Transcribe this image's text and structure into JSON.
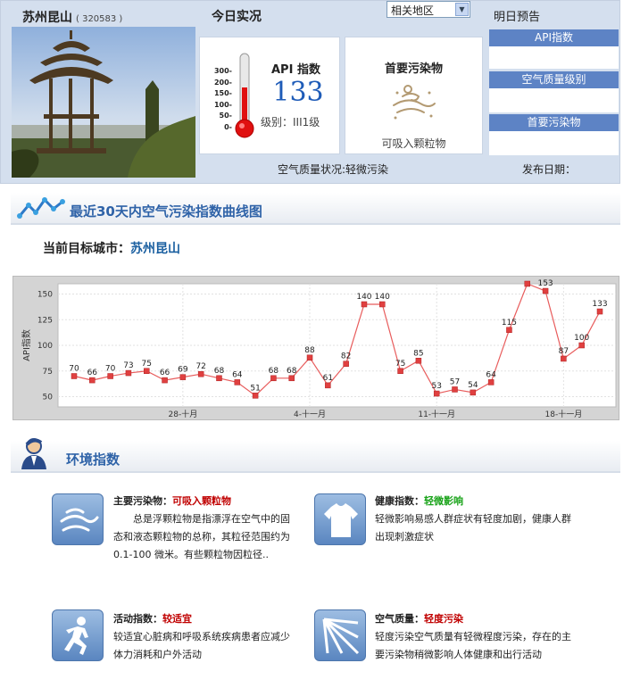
{
  "header": {
    "city": "苏州昆山",
    "code": "( 320583 )",
    "today_title": "今日实况",
    "region_select": "相关地区",
    "tomorrow_title": "明日预告"
  },
  "today": {
    "api_label": "API 指数",
    "api_value": "133",
    "level": "级别：III1级",
    "thermo_ticks": [
      "300-",
      "200-",
      "150-",
      "100-",
      "50-",
      "0-"
    ],
    "primary_pollutant_title": "首要污染物",
    "primary_pollutant": "可吸入颗粒物",
    "air_status": "空气质量状况:轻微污染",
    "publish_date": "发布日期："
  },
  "tomorrow": {
    "api_header": "API指数",
    "level_header": "空气质量级别",
    "pollutant_header": "首要污染物"
  },
  "chart_section": {
    "title": "最近30天内空气污染指数曲线图",
    "target_label": "当前目标城市：",
    "target_city": "苏州昆山"
  },
  "chart_data": {
    "type": "line",
    "ylabel": "API指数",
    "ylim": [
      40,
      160
    ],
    "yticks": [
      50,
      75,
      100,
      125,
      150
    ],
    "xtick_labels": [
      "28-十月",
      "4-十一月",
      "11-十一月",
      "18-十一月"
    ],
    "xtick_index": [
      6,
      13,
      20,
      27
    ],
    "values": [
      70,
      66,
      70,
      73,
      75,
      66,
      69,
      72,
      68,
      64,
      51,
      68,
      68,
      88,
      61,
      82,
      140,
      140,
      75,
      85,
      53,
      57,
      54,
      64,
      115,
      160,
      153,
      87,
      100,
      133
    ],
    "labels": [
      "70",
      "66",
      "70",
      "73",
      "75",
      "66",
      "69",
      "72",
      "68",
      "64",
      "51",
      "68",
      "68",
      "88",
      "61",
      "82",
      "140",
      "140",
      "75",
      "85",
      "53",
      "57",
      "54",
      "64",
      "115",
      "",
      "153",
      "87",
      "100",
      "133"
    ],
    "grid": true,
    "colors": {
      "line": "#e85c5c",
      "marker": "#e04040"
    }
  },
  "env_section": {
    "title": "环境指数",
    "items": [
      {
        "label": "主要污染物：",
        "value": "可吸入颗粒物",
        "value_class": "red",
        "desc": "总是浮颗粒物是指漂浮在空气中的固态和液态颗粒物的总称，其粒径范围约为0.1-100 微米。有些颗粒物因粒径..",
        "icon": "wind-dust-icon"
      },
      {
        "label": "健康指数：",
        "value": "轻微影响",
        "value_class": "green",
        "desc": "轻微影响易感人群症状有轻度加剧，健康人群出现刺激症状",
        "icon": "tshirt-icon"
      },
      {
        "label": "活动指数：",
        "value": "较适宜",
        "value_class": "red",
        "desc": "较适宜心脏病和呼吸系统疾病患者应减少体力消耗和户外活动",
        "icon": "runner-icon"
      },
      {
        "label": "空气质量：",
        "value": "轻度污染",
        "value_class": "red",
        "desc": "轻度污染空气质量有轻微程度污染，存在的主要污染物稍微影响人体健康和出行活动",
        "icon": "sun-rays-icon"
      }
    ]
  }
}
